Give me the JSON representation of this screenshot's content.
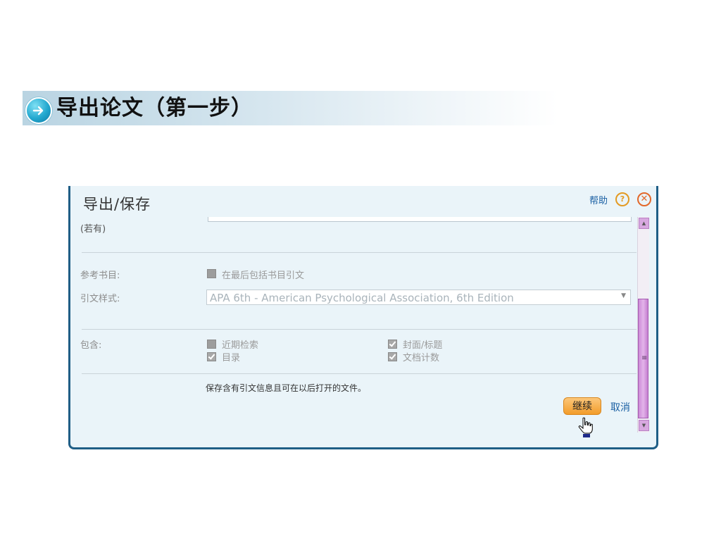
{
  "slide": {
    "title": "导出论文（第一步）",
    "arrow_icon": "circle-arrow-right-icon"
  },
  "dialog": {
    "title": "导出/保存",
    "help_label": "帮助",
    "help_icon": "question-icon",
    "close_icon": "close-icon",
    "partial_row_label": "(若有)",
    "bibliography": {
      "label": "参考书目:",
      "checkbox_label": "在最后包括书目引文",
      "checked": false
    },
    "citation_style": {
      "label": "引文样式:",
      "value": "APA 6th - American Psychological Association, 6th Edition"
    },
    "include": {
      "label": "包含:",
      "options": [
        {
          "label": "近期检索",
          "checked": false
        },
        {
          "label": "封面/标题",
          "checked": true
        },
        {
          "label": "目录",
          "checked": true
        },
        {
          "label": "文档计数",
          "checked": true
        }
      ]
    },
    "note": "保存含有引文信息且可在以后打开的文件。",
    "continue_label": "继续",
    "cancel_label": "取消"
  },
  "colors": {
    "dialog_bg": "#eaf4f9",
    "dialog_border": "#1f5e86",
    "continue_button": "#f29c2a",
    "scrollbar_thumb": "#cc8ad6",
    "link": "#1a5fa3"
  }
}
